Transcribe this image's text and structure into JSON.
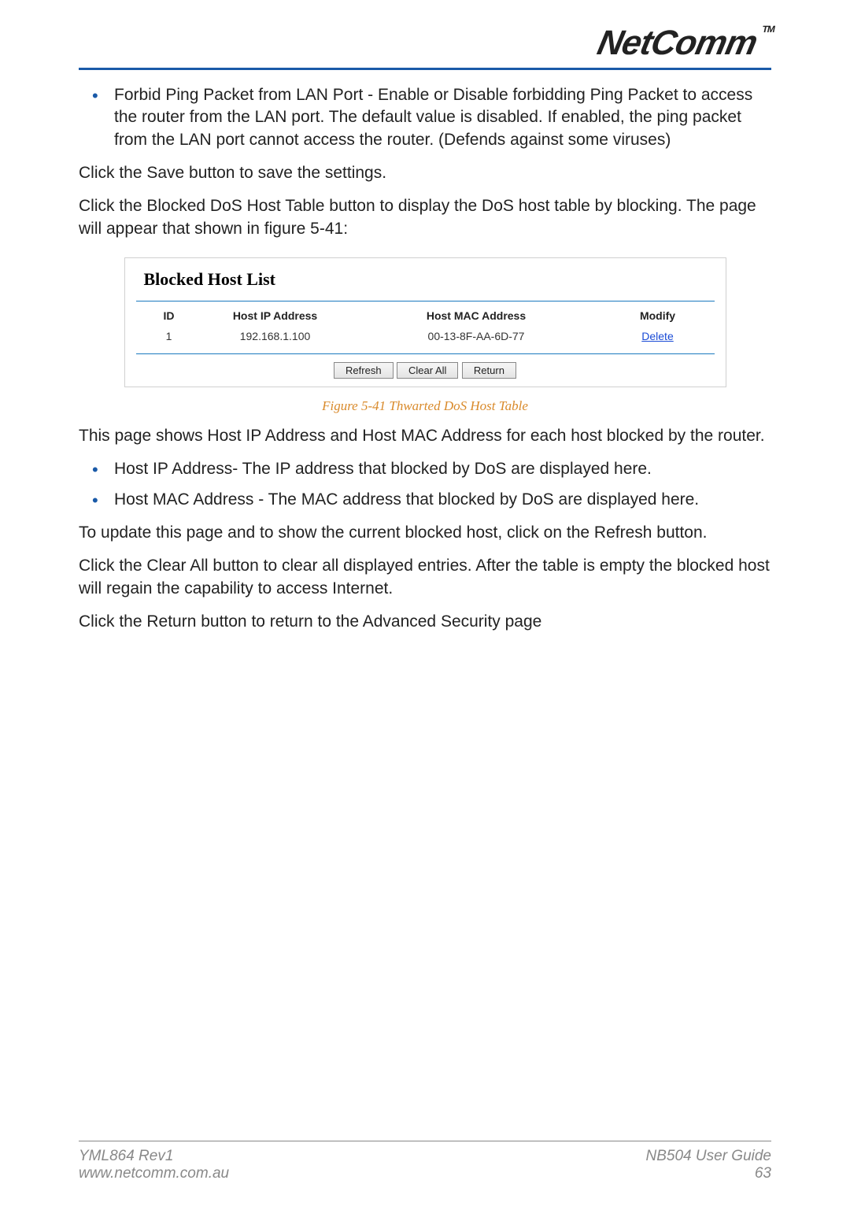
{
  "header": {
    "logo_text": "NetComm",
    "tm": "TM"
  },
  "content": {
    "bullet1": "Forbid Ping Packet from LAN Port - Enable or Disable forbidding Ping Packet to access the router from the LAN port. The default value is disabled. If enabled, the ping packet from the LAN port cannot access the router. (Defends against some viruses)",
    "p_save": "Click the Save button to save the settings.",
    "p_blocked": "Click the Blocked DoS Host Table button to display the DoS host table by blocking. The page will appear that shown in figure 5-41:",
    "p_thispage": "This page shows Host IP Address and Host MAC Address for each host blocked by the router.",
    "bullet_ip": "Host IP Address- The IP address that blocked by DoS are displayed here.",
    "bullet_mac": "Host MAC Address - The MAC address that blocked by DoS are displayed here.",
    "p_refresh": "To update this page and to show the current blocked host, click on the Refresh button.",
    "p_clear": "Click the Clear All button to clear all displayed entries. After the table is empty the blocked host will regain the capability to access Internet.",
    "p_return": "Click the Return button to return to the Advanced Security page"
  },
  "figure": {
    "panel_title": "Blocked Host List",
    "columns": {
      "id": "ID",
      "ip": "Host IP Address",
      "mac": "Host MAC Address",
      "modify": "Modify"
    },
    "row": {
      "id": "1",
      "ip": "192.168.1.100",
      "mac": "00-13-8F-AA-6D-77",
      "modify": "Delete"
    },
    "buttons": {
      "refresh": "Refresh",
      "clear": "Clear All",
      "return": "Return"
    },
    "caption": "Figure 5-41 Thwarted DoS Host Table"
  },
  "footer": {
    "left_line1": "YML864 Rev1",
    "left_line2": "www.netcomm.com.au",
    "right_line1": "NB504 User Guide",
    "right_line2": "63"
  }
}
